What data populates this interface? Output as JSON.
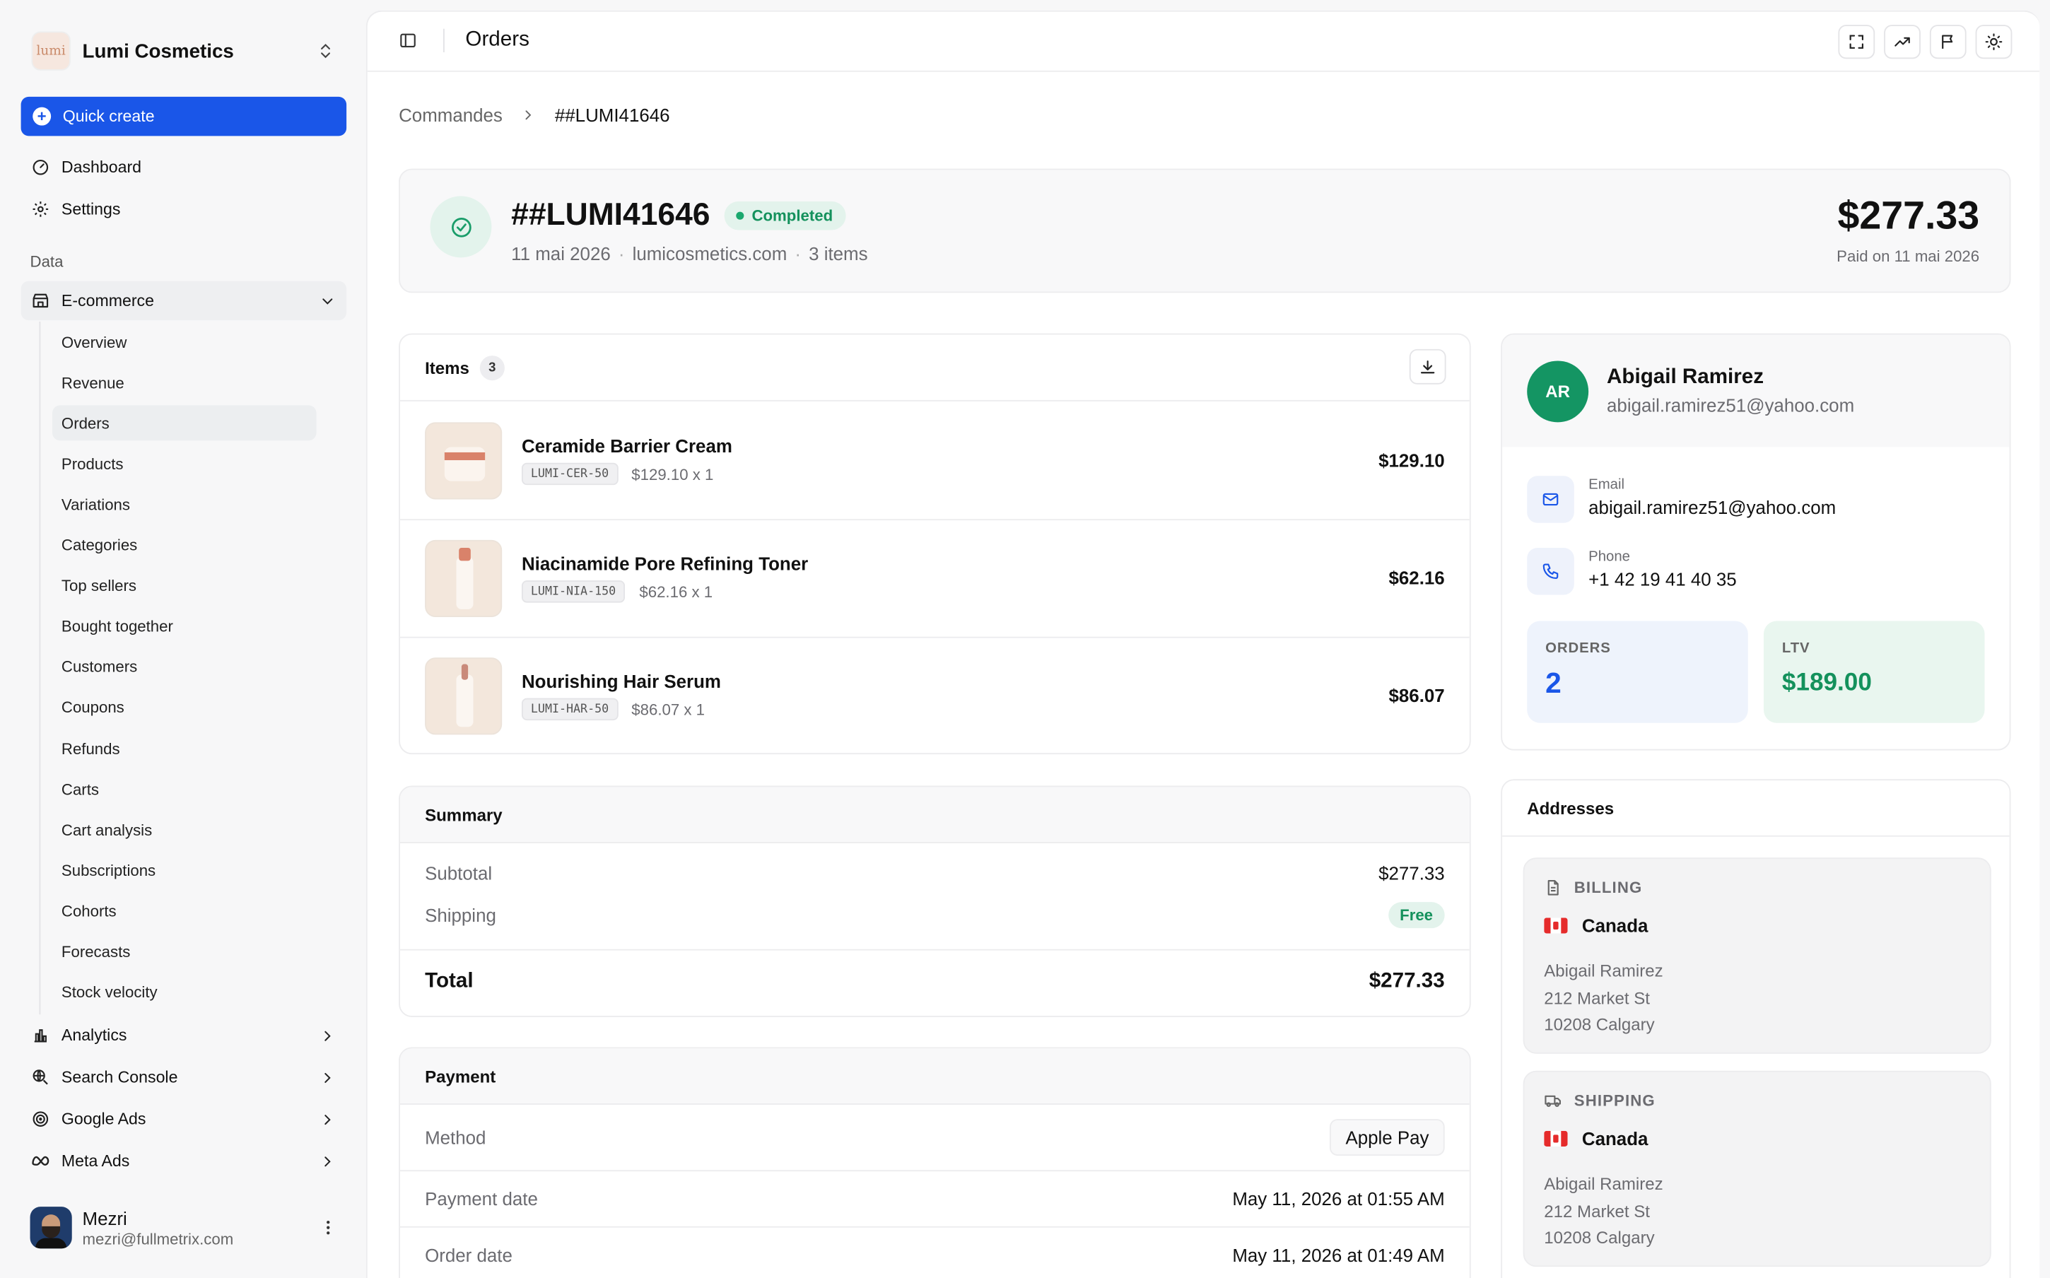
{
  "brand": {
    "name": "Lumi Cosmetics",
    "logo_text": "lumi"
  },
  "sidebar": {
    "quick_create": "Quick create",
    "top_items": [
      {
        "label": "Dashboard",
        "icon": "gauge-icon"
      },
      {
        "label": "Settings",
        "icon": "gear-icon"
      }
    ],
    "section_label": "Data",
    "ecommerce": {
      "label": "E-commerce",
      "icon": "store-icon"
    },
    "sub_items": [
      "Overview",
      "Revenue",
      "Orders",
      "Products",
      "Variations",
      "Categories",
      "Top sellers",
      "Bought together",
      "Customers",
      "Coupons",
      "Refunds",
      "Carts",
      "Cart analysis",
      "Subscriptions",
      "Cohorts",
      "Forecasts",
      "Stock velocity"
    ],
    "active_sub_item": "Orders",
    "groups": [
      {
        "label": "Analytics",
        "icon": "bar-chart-icon"
      },
      {
        "label": "Search Console",
        "icon": "search-globe-icon"
      },
      {
        "label": "Google Ads",
        "icon": "target-icon"
      },
      {
        "label": "Meta Ads",
        "icon": "meta-icon"
      }
    ],
    "user": {
      "name": "Mezri",
      "email": "mezri@fullmetrix.com"
    }
  },
  "topbar": {
    "title": "Orders"
  },
  "breadcrumb": {
    "parent": "Commandes",
    "current": "##LUMI41646"
  },
  "order": {
    "id": "##LUMI41646",
    "status": "Completed",
    "date": "11 mai 2026",
    "store": "lumicosmetics.com",
    "item_count_text": "3 items",
    "total": "$277.33",
    "paid_text": "Paid on 11 mai 2026"
  },
  "items_card": {
    "title": "Items",
    "count": "3",
    "rows": [
      {
        "name": "Ceramide Barrier Cream",
        "sku": "LUMI-CER-50",
        "qty_text": "$129.10 x 1",
        "price": "$129.10"
      },
      {
        "name": "Niacinamide Pore Refining Toner",
        "sku": "LUMI-NIA-150",
        "qty_text": "$62.16 x 1",
        "price": "$62.16"
      },
      {
        "name": "Nourishing Hair Serum",
        "sku": "LUMI-HAR-50",
        "qty_text": "$86.07 x 1",
        "price": "$86.07"
      }
    ]
  },
  "summary": {
    "title": "Summary",
    "subtotal_label": "Subtotal",
    "subtotal": "$277.33",
    "shipping_label": "Shipping",
    "shipping": "Free",
    "total_label": "Total",
    "total": "$277.33"
  },
  "payment": {
    "title": "Payment",
    "method_label": "Method",
    "method": "Apple Pay",
    "payment_date_label": "Payment date",
    "payment_date": "May 11, 2026 at 01:55 AM",
    "order_date_label": "Order date",
    "order_date": "May 11, 2026 at 01:49 AM"
  },
  "customer": {
    "initials": "AR",
    "name": "Abigail Ramirez",
    "email": "abigail.ramirez51@yahoo.com",
    "email_label": "Email",
    "phone_label": "Phone",
    "phone": "+1 42 19 41 40 35",
    "orders_label": "ORDERS",
    "orders": "2",
    "ltv_label": "LTV",
    "ltv": "$189.00"
  },
  "addresses": {
    "title": "Addresses",
    "billing": {
      "label": "BILLING",
      "country": "Canada",
      "name": "Abigail Ramirez",
      "street": "212 Market St",
      "city": "10208 Calgary"
    },
    "shipping": {
      "label": "SHIPPING",
      "country": "Canada",
      "name": "Abigail Ramirez",
      "street": "212 Market St",
      "city": "10208 Calgary"
    }
  },
  "colors": {
    "accent": "#1a56e8",
    "success": "#14915c",
    "avatar": "#149563"
  }
}
